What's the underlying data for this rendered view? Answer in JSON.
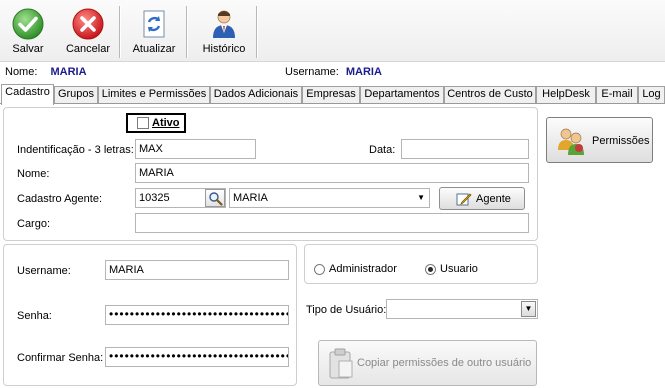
{
  "toolbar": {
    "save_label": "Salvar",
    "cancel_label": "Cancelar",
    "refresh_label": "Atualizar",
    "history_label": "Histórico"
  },
  "info": {
    "name_label": "Nome:",
    "name_value": "MARIA",
    "username_label": "Username:",
    "username_value": "MARIA"
  },
  "tabs": [
    {
      "label": "Cadastro"
    },
    {
      "label": "Grupos"
    },
    {
      "label": "Limites e Permissões"
    },
    {
      "label": "Dados Adicionais"
    },
    {
      "label": "Empresas"
    },
    {
      "label": "Departamentos"
    },
    {
      "label": "Centros de Custo"
    },
    {
      "label": "HelpDesk"
    },
    {
      "label": "E-mail"
    },
    {
      "label": "Log"
    }
  ],
  "cadastro": {
    "ativo_label": "Ativo",
    "ativo_checked": false,
    "identificacao_label": "Indentificação - 3 letras:",
    "identificacao_value": "MAX",
    "data_label": "Data:",
    "data_value": "",
    "nome_label": "Nome:",
    "nome_value": "MARIA",
    "agente_label": "Cadastro Agente:",
    "agente_code": "10325",
    "agente_name": "MARIA",
    "agente_button": "Agente",
    "cargo_label": "Cargo:",
    "cargo_value": ""
  },
  "permissoes_button": "Permissões",
  "login": {
    "username_label": "Username:",
    "username_value": "MARIA",
    "senha_label": "Senha:",
    "senha_value": "••••••••••••••••••••••••••••••••••••••••",
    "confirmar_label": "Confirmar Senha:",
    "confirmar_value": "••••••••••••••••••••••••••••••••••••••••"
  },
  "role": {
    "administrador_label": "Administrador",
    "usuario_label": "Usuario",
    "selected": "Usuario",
    "tipo_label": "Tipo de Usuário:",
    "tipo_value": "",
    "copiar_label": "Copiar permissões de outro usuário"
  },
  "colors": {
    "info_value": "#1c1c8c",
    "save_icon": "#3fa336",
    "cancel_icon": "#d8232a"
  }
}
